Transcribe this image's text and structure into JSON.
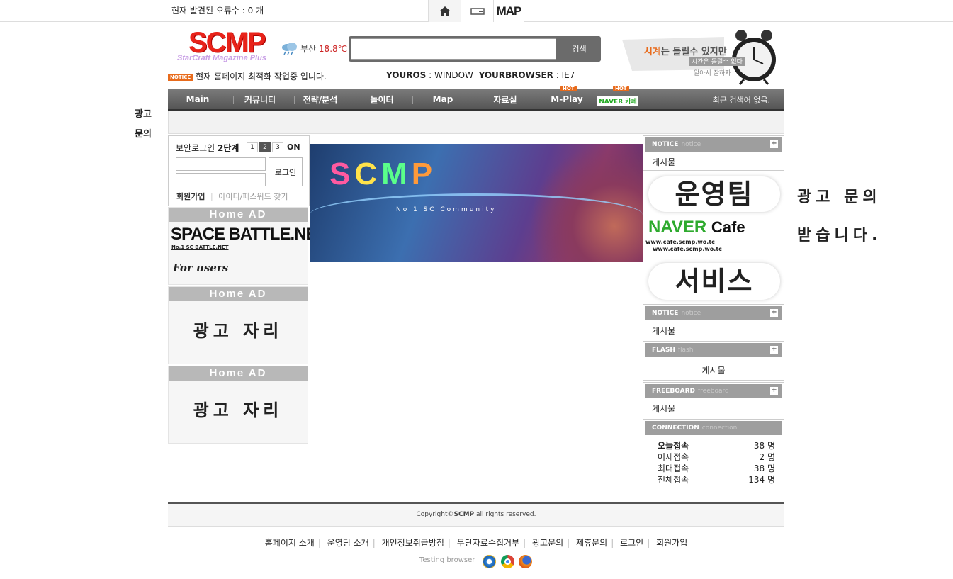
{
  "topbar": {
    "error_label": "현재 발견된 오류수 : 0 개",
    "map_label": "MAP"
  },
  "logo": {
    "main": "SCMP",
    "sub": "StarCraft Magazine Plus"
  },
  "weather": {
    "city": "부산",
    "temp": "18.8℃"
  },
  "search": {
    "button_label": "검색",
    "value": ""
  },
  "clock_banner": {
    "line1_highlight": "시계",
    "line1_rest": "는 돌릴수 있지만",
    "line2": "시간은 돌릴수 없다",
    "line3": "알아서 잘하자"
  },
  "notice": {
    "badge": "NOTICE",
    "text": "현재 홈페이지 최적화 작업중 입니다."
  },
  "osinfo": {
    "os_label": "YOUROS",
    "os_value": ": WINDOW",
    "browser_label": "YOURBROWSER",
    "browser_value": ": IE7"
  },
  "nav": {
    "items": [
      "Main",
      "커뮤니티",
      "전략/분석",
      "놀이터",
      "Map",
      "자료실",
      "M-Play",
      "NAVER 카페"
    ],
    "hot_label": "HOT",
    "recent_search": "최근 검색어 없음."
  },
  "left_ad": {
    "chars": [
      "광고",
      "문의"
    ]
  },
  "login": {
    "title_pre": "보안로그인 ",
    "title_step": "2단계",
    "steps": [
      "1",
      "2",
      "3"
    ],
    "on_label": "ON",
    "login_button": "로그인",
    "signup": "회원가입",
    "find": "아이디/패스워드 찾기"
  },
  "home_ads": {
    "header": "Home AD",
    "first_title": "SPACE BATTLE.NET",
    "first_sub": "No.1 SC BATTLE.NET",
    "first_users": "For users",
    "placeholder": "광고 자리"
  },
  "banner": {
    "logo": "SCMP",
    "sub": "No.1 SC Community"
  },
  "right": {
    "notice_title": "NOTICE",
    "notice_sub": "notice",
    "post": "게시물",
    "flash_title": "FLASH",
    "flash_sub": "flash",
    "freeboard_title": "FREEBOARD",
    "freeboard_sub": "freeboard",
    "connection_title": "CONNECTION",
    "connection_sub": "connection",
    "team": {
      "line1": "운영팀",
      "naver": "NAVER",
      "cafe": "Cafe",
      "url1": "www.cafe.scmp.wo.tc",
      "url2": "www.cafe.scmp.wo.tc",
      "line3": "서비스"
    },
    "connections": [
      {
        "label": "오늘접속",
        "value": "38 명"
      },
      {
        "label": "어제접속",
        "value": "2 명"
      },
      {
        "label": "최대접속",
        "value": "38 명"
      },
      {
        "label": "전체접속",
        "value": "134 명"
      }
    ]
  },
  "right_ad": {
    "line1": "광고 문의",
    "line2": "받습니다."
  },
  "footer": {
    "copyright_pre": "Copyright©",
    "copyright_brand": "SCMP",
    "copyright_post": " all rights reserved.",
    "links": [
      "홈페이지 소개",
      "운영팀 소개",
      "개인정보취급방침",
      "무단자료수집거부",
      "광고문의",
      "제휴문의",
      "로그인",
      "회원가입"
    ],
    "testing": "Testing browser"
  },
  "colors": {
    "accent": "#e86b1c",
    "nav": "#666666",
    "logo_red": "#e8231a"
  }
}
